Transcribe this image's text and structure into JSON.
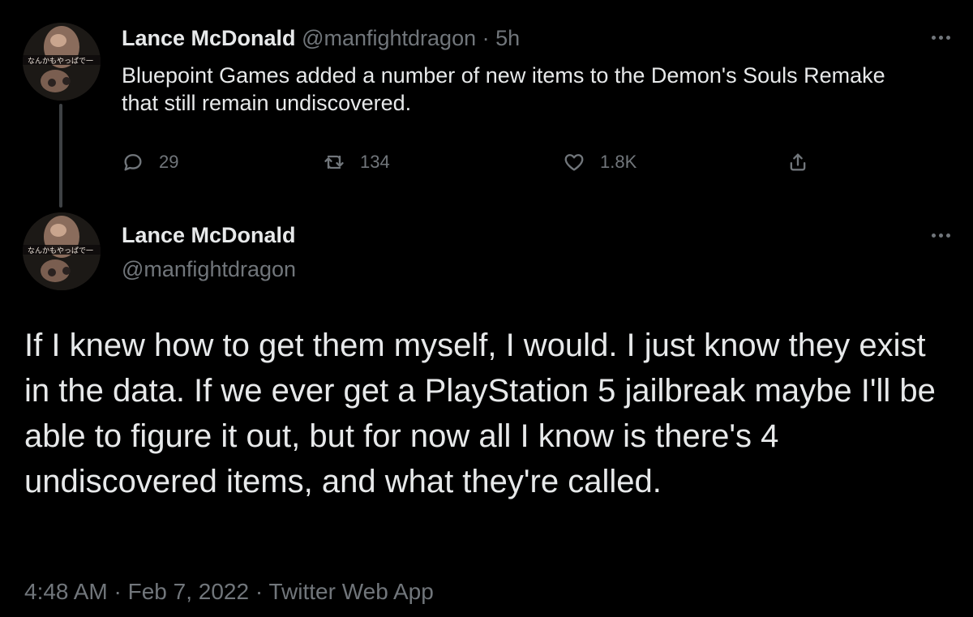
{
  "parent_tweet": {
    "author_name": "Lance McDonald",
    "author_handle": "@manfightdragon",
    "separator": "·",
    "time_ago": "5h",
    "text": "Bluepoint Games added a number of new items to the Demon's Souls Remake that still remain undiscovered.",
    "reply_count": "29",
    "retweet_count": "134",
    "like_count": "1.8K"
  },
  "main_tweet": {
    "author_name": "Lance McDonald",
    "author_handle": "@manfightdragon",
    "text": "If I knew how to get them myself, I would. I just know they exist in the data. If we ever get a PlayStation 5 jailbreak maybe I'll be able to figure it out, but for now all I know is there's 4 undiscovered items, and what they're called.",
    "time": "4:48 AM",
    "date": "Feb 7, 2022",
    "source": "Twitter Web App",
    "dot": "·"
  },
  "avatar_caption": "なんかもやっぱで一",
  "colors": {
    "background": "#000000",
    "text": "#e7e9ea",
    "muted": "#71767b",
    "thread_line": "#3e4144"
  },
  "icons": {
    "reply": "reply-icon",
    "retweet": "retweet-icon",
    "like": "heart-icon",
    "share": "share-icon",
    "more": "more-dots-icon"
  }
}
